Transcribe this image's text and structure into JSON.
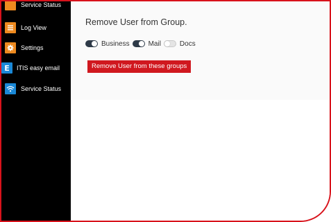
{
  "sidebar": {
    "items": [
      {
        "label": "Service Status",
        "icon": "service-status-icon"
      },
      {
        "label": "Log View",
        "icon": "log-list-icon"
      },
      {
        "label": "Settings",
        "icon": "gear-icon"
      },
      {
        "label": "ITIS easy email",
        "icon": "e-letter-icon"
      },
      {
        "label": "Service Status",
        "icon": "wifi-icon"
      }
    ]
  },
  "main": {
    "title": "Remove User from Group.",
    "groups": [
      {
        "label": "Business",
        "enabled": true
      },
      {
        "label": "Mail",
        "enabled": true
      },
      {
        "label": "Docs",
        "enabled": false
      }
    ],
    "remove_button_label": "Remove User from these groups"
  },
  "colors": {
    "frame": "#d8121b",
    "sidebar_bg": "#000000",
    "icon_orange": "#ee8a1f",
    "icon_blue": "#1a88d6",
    "button_red": "#d0181f",
    "toggle_on": "#2e3a48"
  }
}
